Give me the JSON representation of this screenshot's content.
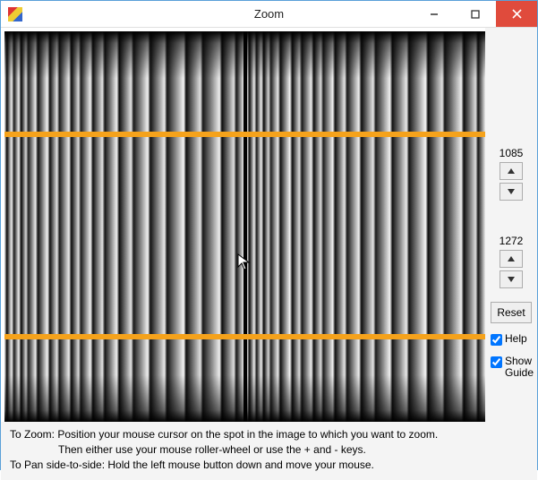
{
  "window": {
    "title": "Zoom"
  },
  "controls": {
    "value1": "1085",
    "value2": "1272",
    "reset_label": "Reset",
    "help_label": "Help",
    "help_checked": true,
    "showguide_label": "Show Guide",
    "showguide_checked": true
  },
  "help": {
    "line1": "To Zoom: Position your mouse cursor on the spot in the image to which you want to zoom.",
    "line2": "Then either use your mouse roller-wheel or use the + and - keys.",
    "line3": "To Pan side-to-side:  Hold the left mouse button down and move your mouse."
  },
  "guides": {
    "color": "#f5a21b"
  }
}
